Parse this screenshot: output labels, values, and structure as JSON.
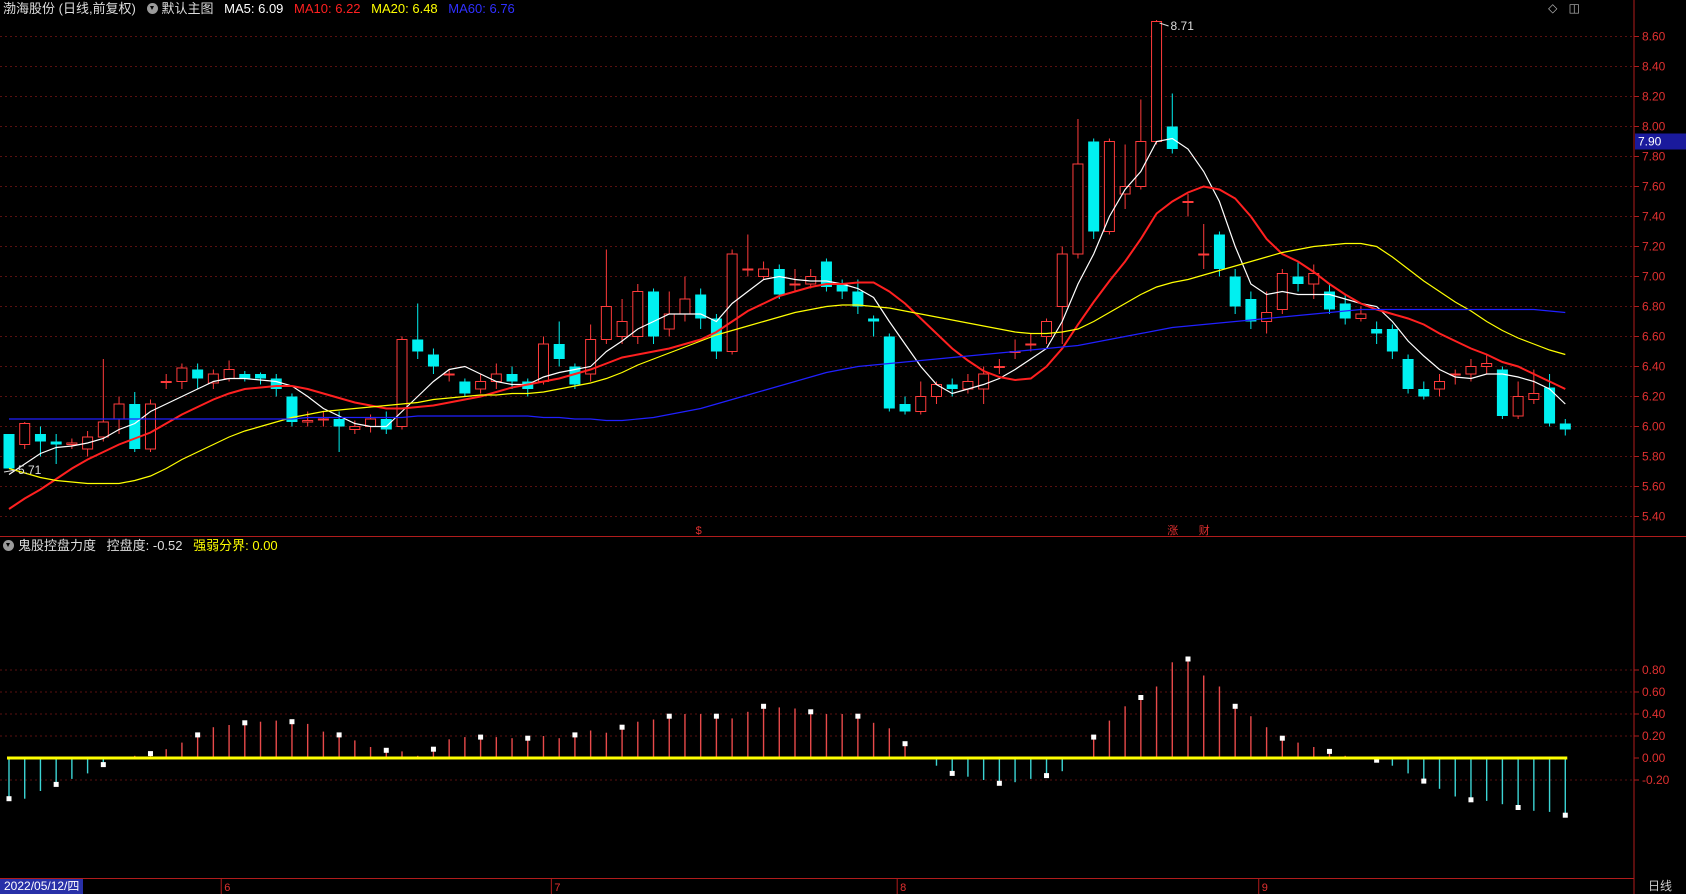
{
  "header": {
    "stock_name": "渤海股份 (日线,前复权)",
    "main_chart_label": "默认主图",
    "ma5": {
      "label": "MA5: 6.09",
      "color": "#ffffff"
    },
    "ma10": {
      "label": "MA10: 6.22",
      "color": "#ff2020"
    },
    "ma20": {
      "label": "MA20: 6.48",
      "color": "#ffff00"
    },
    "ma60": {
      "label": "MA60: 6.76",
      "color": "#2020ff"
    }
  },
  "indicator_header": {
    "name": "鬼股控盘力度",
    "value_label": "控盘度: -0.52",
    "boundary_label": "强弱分界: 0.00"
  },
  "footer": {
    "start_date": "2022/05/12/四",
    "period": "日线"
  },
  "icons": [
    "diamond-icon",
    "window-restore-icon",
    "collapse-circle-icon"
  ],
  "chart_data": [
    {
      "type": "candlestick",
      "title": "",
      "y_axis_ticks": [
        "8.60",
        "8.40",
        "8.20",
        "8.00",
        "7.80",
        "7.60",
        "7.40",
        "7.20",
        "7.00",
        "6.80",
        "6.60",
        "6.40",
        "6.20",
        "6.00",
        "5.80",
        "5.60",
        "5.40"
      ],
      "ylim": [
        5.33,
        8.75
      ],
      "current_price": "7.90",
      "max_label": "8.71",
      "min_label": "5.71",
      "month_labels": [
        {
          "index": 14,
          "label": "6"
        },
        {
          "index": 35,
          "label": "7"
        },
        {
          "index": 57,
          "label": "8"
        },
        {
          "index": 80,
          "label": "9"
        }
      ],
      "event_markers": [
        {
          "index": 44,
          "label": "$"
        },
        {
          "index": 74,
          "label": "涨"
        },
        {
          "index": 76,
          "label": "财"
        }
      ],
      "candles": [
        [
          5.95,
          5.72,
          5.8,
          5.9
        ],
        [
          5.88,
          6.02,
          6.03,
          5.85
        ],
        [
          5.95,
          5.9,
          6.0,
          5.8
        ],
        [
          5.9,
          5.88,
          5.95,
          5.75
        ],
        [
          5.88,
          5.89,
          5.92,
          5.85
        ],
        [
          5.85,
          5.93,
          5.97,
          5.8
        ],
        [
          5.93,
          6.03,
          6.45,
          5.9
        ],
        [
          6.05,
          6.15,
          6.2,
          5.95
        ],
        [
          6.15,
          5.85,
          6.23,
          5.83
        ],
        [
          5.85,
          6.15,
          6.18,
          5.83
        ],
        [
          6.3,
          6.3,
          6.35,
          6.25
        ],
        [
          6.3,
          6.39,
          6.42,
          6.25
        ],
        [
          6.38,
          6.32,
          6.42,
          6.25
        ],
        [
          6.29,
          6.35,
          6.38,
          6.25
        ],
        [
          6.32,
          6.38,
          6.44,
          6.3
        ],
        [
          6.35,
          6.32,
          6.37,
          6.3
        ],
        [
          6.35,
          6.32,
          6.36,
          6.28
        ],
        [
          6.32,
          6.25,
          6.35,
          6.2
        ],
        [
          6.2,
          6.03,
          6.22,
          6.0
        ],
        [
          6.03,
          6.04,
          6.1,
          6.0
        ],
        [
          6.05,
          6.05,
          6.1,
          6.0
        ],
        [
          6.05,
          6.0,
          6.1,
          5.83
        ],
        [
          5.98,
          6.0,
          6.04,
          5.95
        ],
        [
          6.0,
          6.05,
          6.08,
          5.96
        ],
        [
          6.05,
          5.98,
          6.1,
          5.95
        ],
        [
          6.0,
          6.58,
          6.6,
          5.98
        ],
        [
          6.58,
          6.5,
          6.82,
          6.45
        ],
        [
          6.48,
          6.4,
          6.52,
          6.35
        ],
        [
          6.35,
          6.35,
          6.38,
          6.3
        ],
        [
          6.3,
          6.22,
          6.32,
          6.2
        ],
        [
          6.25,
          6.3,
          6.35,
          6.22
        ],
        [
          6.3,
          6.35,
          6.42,
          6.25
        ],
        [
          6.35,
          6.3,
          6.4,
          6.25
        ],
        [
          6.3,
          6.25,
          6.32,
          6.2
        ],
        [
          6.3,
          6.55,
          6.6,
          6.28
        ],
        [
          6.55,
          6.45,
          6.7,
          6.4
        ],
        [
          6.4,
          6.28,
          6.42,
          6.25
        ],
        [
          6.35,
          6.58,
          6.68,
          6.3
        ],
        [
          6.58,
          6.8,
          7.18,
          6.55
        ],
        [
          6.6,
          6.7,
          6.85,
          6.55
        ],
        [
          6.6,
          6.9,
          6.95,
          6.55
        ],
        [
          6.9,
          6.6,
          6.92,
          6.55
        ],
        [
          6.65,
          6.75,
          6.9,
          6.6
        ],
        [
          6.75,
          6.85,
          7.0,
          6.7
        ],
        [
          6.88,
          6.72,
          6.92,
          6.65
        ],
        [
          6.72,
          6.5,
          6.75,
          6.45
        ],
        [
          6.5,
          7.15,
          7.18,
          6.48
        ],
        [
          7.05,
          7.05,
          7.28,
          7.0
        ],
        [
          7.0,
          7.05,
          7.1,
          6.98
        ],
        [
          7.05,
          6.88,
          7.08,
          6.85
        ],
        [
          6.95,
          6.95,
          7.05,
          6.9
        ],
        [
          6.95,
          7.0,
          7.05,
          6.92
        ],
        [
          7.1,
          6.93,
          7.12,
          6.9
        ],
        [
          6.95,
          6.9,
          6.98,
          6.85
        ],
        [
          6.9,
          6.8,
          6.98,
          6.75
        ],
        [
          6.72,
          6.7,
          6.74,
          6.6
        ],
        [
          6.6,
          6.12,
          6.62,
          6.1
        ],
        [
          6.15,
          6.1,
          6.2,
          6.08
        ],
        [
          6.1,
          6.2,
          6.3,
          6.08
        ],
        [
          6.2,
          6.28,
          6.3,
          6.15
        ],
        [
          6.28,
          6.25,
          6.32,
          6.2
        ],
        [
          6.25,
          6.3,
          6.35,
          6.22
        ],
        [
          6.25,
          6.35,
          6.4,
          6.15
        ],
        [
          6.4,
          6.4,
          6.45,
          6.35
        ],
        [
          6.5,
          6.5,
          6.58,
          6.45
        ],
        [
          6.55,
          6.55,
          6.62,
          6.5
        ],
        [
          6.6,
          6.7,
          6.72,
          6.55
        ],
        [
          6.8,
          7.15,
          7.2,
          6.55
        ],
        [
          7.15,
          7.75,
          8.05,
          7.12
        ],
        [
          7.9,
          7.3,
          7.92,
          7.25
        ],
        [
          7.3,
          7.9,
          7.92,
          7.28
        ],
        [
          7.55,
          7.6,
          7.88,
          7.45
        ],
        [
          7.6,
          7.9,
          8.18,
          7.58
        ],
        [
          7.9,
          8.7,
          8.71,
          7.88
        ],
        [
          8.0,
          7.85,
          8.22,
          7.82
        ],
        [
          7.5,
          7.5,
          7.55,
          7.4
        ],
        [
          7.15,
          7.15,
          7.35,
          7.05
        ],
        [
          7.28,
          7.05,
          7.3,
          7.0
        ],
        [
          7.0,
          6.8,
          7.05,
          6.75
        ],
        [
          6.85,
          6.7,
          6.9,
          6.65
        ],
        [
          6.7,
          6.76,
          6.9,
          6.62
        ],
        [
          6.78,
          7.02,
          7.05,
          6.75
        ],
        [
          7.0,
          6.95,
          7.1,
          6.9
        ],
        [
          6.95,
          7.02,
          7.08,
          6.85
        ],
        [
          6.9,
          6.78,
          6.95,
          6.75
        ],
        [
          6.82,
          6.72,
          6.88,
          6.68
        ],
        [
          6.72,
          6.75,
          6.8,
          6.7
        ],
        [
          6.65,
          6.62,
          6.7,
          6.55
        ],
        [
          6.65,
          6.5,
          6.68,
          6.45
        ],
        [
          6.45,
          6.25,
          6.48,
          6.22
        ],
        [
          6.25,
          6.2,
          6.3,
          6.18
        ],
        [
          6.25,
          6.3,
          6.35,
          6.2
        ],
        [
          6.35,
          6.35,
          6.38,
          6.28
        ],
        [
          6.35,
          6.4,
          6.45,
          6.3
        ],
        [
          6.4,
          6.42,
          6.48,
          6.35
        ],
        [
          6.38,
          6.07,
          6.4,
          6.05
        ],
        [
          6.07,
          6.2,
          6.3,
          6.05
        ],
        [
          6.18,
          6.22,
          6.38,
          6.15
        ],
        [
          6.26,
          6.02,
          6.35,
          6.0
        ],
        [
          6.02,
          5.98,
          6.05,
          5.94
        ]
      ],
      "series": [
        {
          "name": "MA5",
          "color": "#ffffff",
          "start_index": 0,
          "values": [
            5.68,
            5.75,
            5.82,
            5.86,
            5.87,
            5.89,
            5.92,
            5.98,
            6.02,
            6.1,
            6.15,
            6.2,
            6.25,
            6.3,
            6.32,
            6.32,
            6.31,
            6.3,
            6.27,
            6.2,
            6.12,
            6.07,
            6.02,
            6.0,
            6.0,
            6.1,
            6.2,
            6.3,
            6.38,
            6.4,
            6.35,
            6.3,
            6.28,
            6.28,
            6.33,
            6.36,
            6.38,
            6.4,
            6.5,
            6.57,
            6.65,
            6.7,
            6.75,
            6.75,
            6.75,
            6.7,
            6.82,
            6.9,
            6.98,
            7.0,
            6.98,
            6.97,
            6.97,
            6.95,
            6.92,
            6.86,
            6.7,
            6.55,
            6.4,
            6.28,
            6.22,
            6.25,
            6.28,
            6.32,
            6.38,
            6.45,
            6.52,
            6.7,
            6.95,
            7.15,
            7.4,
            7.58,
            7.7,
            7.9,
            7.92,
            7.85,
            7.7,
            7.5,
            7.2,
            6.95,
            6.88,
            6.9,
            6.88,
            6.88,
            6.88,
            6.85,
            6.82,
            6.8,
            6.7,
            6.57,
            6.47,
            6.38,
            6.33,
            6.32,
            6.35,
            6.35,
            6.33,
            6.3,
            6.25,
            6.15
          ]
        },
        {
          "name": "MA10",
          "color": "#ff2020",
          "start_index": 0,
          "values": [
            5.45,
            5.52,
            5.58,
            5.65,
            5.72,
            5.78,
            5.83,
            5.88,
            5.92,
            5.96,
            6.02,
            6.08,
            6.13,
            6.18,
            6.22,
            6.25,
            6.26,
            6.27,
            6.27,
            6.25,
            6.22,
            6.19,
            6.16,
            6.14,
            6.12,
            6.12,
            6.13,
            6.14,
            6.16,
            6.18,
            6.2,
            6.23,
            6.26,
            6.28,
            6.3,
            6.32,
            6.35,
            6.38,
            6.42,
            6.46,
            6.48,
            6.5,
            6.52,
            6.55,
            6.58,
            6.63,
            6.7,
            6.77,
            6.82,
            6.87,
            6.9,
            6.93,
            6.95,
            6.95,
            6.96,
            6.96,
            6.9,
            6.82,
            6.72,
            6.62,
            6.52,
            6.44,
            6.37,
            6.33,
            6.31,
            6.32,
            6.4,
            6.52,
            6.68,
            6.83,
            6.97,
            7.1,
            7.25,
            7.42,
            7.5,
            7.56,
            7.6,
            7.58,
            7.52,
            7.4,
            7.25,
            7.15,
            7.1,
            7.03,
            6.95,
            6.88,
            6.82,
            6.78,
            6.75,
            6.72,
            6.68,
            6.62,
            6.57,
            6.52,
            6.48,
            6.43,
            6.4,
            6.35,
            6.3,
            6.25
          ]
        },
        {
          "name": "MA20",
          "color": "#ffff00",
          "start_index": 0,
          "values": [
            5.72,
            5.69,
            5.66,
            5.64,
            5.63,
            5.62,
            5.62,
            5.62,
            5.64,
            5.67,
            5.72,
            5.78,
            5.83,
            5.88,
            5.93,
            5.97,
            6.0,
            6.03,
            6.06,
            6.08,
            6.1,
            6.11,
            6.12,
            6.13,
            6.14,
            6.15,
            6.16,
            6.18,
            6.19,
            6.2,
            6.21,
            6.21,
            6.22,
            6.22,
            6.23,
            6.25,
            6.27,
            6.29,
            6.32,
            6.36,
            6.41,
            6.45,
            6.49,
            6.53,
            6.57,
            6.61,
            6.64,
            6.67,
            6.7,
            6.73,
            6.76,
            6.78,
            6.8,
            6.81,
            6.81,
            6.8,
            6.79,
            6.77,
            6.75,
            6.73,
            6.71,
            6.69,
            6.67,
            6.65,
            6.63,
            6.62,
            6.62,
            6.63,
            6.65,
            6.7,
            6.76,
            6.82,
            6.88,
            6.93,
            6.96,
            6.98,
            7.01,
            7.04,
            7.07,
            7.1,
            7.13,
            7.16,
            7.18,
            7.2,
            7.21,
            7.22,
            7.22,
            7.2,
            7.13,
            7.05,
            6.97,
            6.9,
            6.83,
            6.77,
            6.7,
            6.64,
            6.59,
            6.55,
            6.51,
            6.48
          ]
        },
        {
          "name": "MA60",
          "color": "#2020ff",
          "start_index": 0,
          "values": [
            6.05,
            6.05,
            6.05,
            6.05,
            6.05,
            6.05,
            6.05,
            6.05,
            6.05,
            6.05,
            6.05,
            6.05,
            6.05,
            6.05,
            6.05,
            6.05,
            6.05,
            6.05,
            6.05,
            6.06,
            6.06,
            6.06,
            6.06,
            6.06,
            6.06,
            6.06,
            6.07,
            6.07,
            6.07,
            6.07,
            6.07,
            6.07,
            6.07,
            6.07,
            6.06,
            6.06,
            6.05,
            6.05,
            6.04,
            6.04,
            6.05,
            6.06,
            6.08,
            6.1,
            6.12,
            6.15,
            6.18,
            6.21,
            6.24,
            6.27,
            6.3,
            6.33,
            6.36,
            6.38,
            6.4,
            6.41,
            6.42,
            6.43,
            6.44,
            6.45,
            6.46,
            6.47,
            6.48,
            6.49,
            6.5,
            6.51,
            6.52,
            6.53,
            6.54,
            6.56,
            6.58,
            6.6,
            6.62,
            6.64,
            6.66,
            6.67,
            6.68,
            6.69,
            6.7,
            6.71,
            6.72,
            6.73,
            6.74,
            6.75,
            6.76,
            6.77,
            6.78,
            6.78,
            6.78,
            6.78,
            6.78,
            6.78,
            6.78,
            6.78,
            6.78,
            6.78,
            6.78,
            6.78,
            6.77,
            6.76
          ]
        }
      ]
    },
    {
      "type": "bar",
      "title": "",
      "y_axis_ticks": [
        "0.80",
        "0.60",
        "0.40",
        "0.20",
        "0.00",
        "-0.20"
      ],
      "ylim": [
        -0.56,
        0.96
      ],
      "boundary": 0.0,
      "positive_color": "#e84a4a",
      "negative_color": "#3cd4d4",
      "values": [
        -0.37,
        -0.37,
        -0.3,
        -0.24,
        -0.19,
        -0.14,
        -0.06,
        0.0,
        0.02,
        0.04,
        0.08,
        0.14,
        0.21,
        0.28,
        0.3,
        0.32,
        0.33,
        0.34,
        0.33,
        0.31,
        0.24,
        0.21,
        0.16,
        0.1,
        0.07,
        0.06,
        0.02,
        0.08,
        0.17,
        0.19,
        0.19,
        0.19,
        0.18,
        0.18,
        0.2,
        0.18,
        0.21,
        0.25,
        0.23,
        0.28,
        0.33,
        0.35,
        0.38,
        0.4,
        0.4,
        0.38,
        0.36,
        0.42,
        0.47,
        0.46,
        0.45,
        0.42,
        0.4,
        0.4,
        0.38,
        0.32,
        0.27,
        0.13,
        0.0,
        -0.07,
        -0.14,
        -0.17,
        -0.2,
        -0.23,
        -0.22,
        -0.19,
        -0.16,
        -0.12,
        0.0,
        0.19,
        0.34,
        0.47,
        0.55,
        0.65,
        0.87,
        0.9,
        0.75,
        0.65,
        0.47,
        0.38,
        0.28,
        0.18,
        0.14,
        0.1,
        0.06,
        0.02,
        0.0,
        -0.02,
        -0.07,
        -0.14,
        -0.21,
        -0.28,
        -0.35,
        -0.38,
        -0.39,
        -0.42,
        -0.45,
        -0.48,
        -0.49,
        -0.52
      ]
    }
  ]
}
